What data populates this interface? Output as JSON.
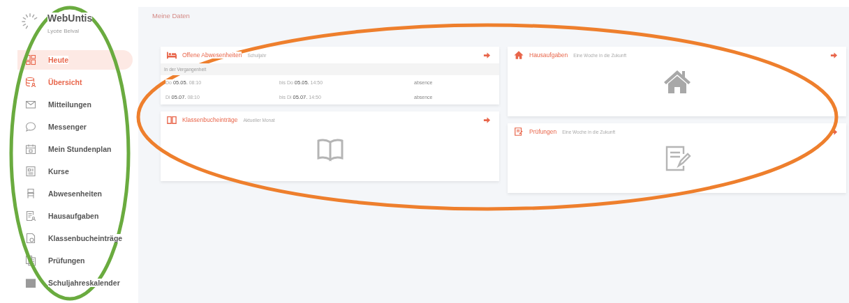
{
  "sidebar": {
    "app_name": "WebUntis",
    "school": "Lycée Belval",
    "items": [
      {
        "label": "Heute",
        "selected": true,
        "highlighted": true
      },
      {
        "label": "Übersicht",
        "selected": false,
        "highlighted": true
      },
      {
        "label": "Mitteilungen",
        "selected": false,
        "highlighted": false
      },
      {
        "label": "Messenger",
        "selected": false,
        "highlighted": false
      },
      {
        "label": "Mein Stundenplan",
        "selected": false,
        "highlighted": false
      },
      {
        "label": "Kurse",
        "selected": false,
        "highlighted": false
      },
      {
        "label": "Abwesenheiten",
        "selected": false,
        "highlighted": false
      },
      {
        "label": "Hausaufgaben",
        "selected": false,
        "highlighted": false
      },
      {
        "label": "Klassenbucheinträge",
        "selected": false,
        "highlighted": false
      },
      {
        "label": "Prüfungen",
        "selected": false,
        "highlighted": false
      },
      {
        "label": "Schuljahreskalender",
        "selected": false,
        "highlighted": false
      }
    ]
  },
  "page_title": "Meine Daten",
  "columns": [
    [
      {
        "kind": "absences",
        "title": "Offene Abwesenheiten",
        "subtitle": "Schuljahr",
        "section": "In der Vergangenheit",
        "rows": [
          {
            "from_day": "Do",
            "from_date": "05.05.",
            "from_time": "08:10",
            "to_day": "bis Do",
            "to_date": "05.05.",
            "to_time": "14:50",
            "reason": "absence"
          },
          {
            "from_day": "Di",
            "from_date": "05.07.",
            "from_time": "08:10",
            "to_day": "bis Di",
            "to_date": "05.07.",
            "to_time": "14:50",
            "reason": "absence"
          }
        ]
      },
      {
        "kind": "empty",
        "title": "Klassenbucheinträge",
        "subtitle": "Aktueller Monat"
      }
    ],
    [
      {
        "kind": "empty",
        "title": "Hausaufgaben",
        "subtitle": "Eine Woche in die Zukunft"
      },
      {
        "kind": "empty",
        "title": "Prüfungen",
        "subtitle": "Eine Woche in die Zukunft"
      }
    ]
  ],
  "annotations": [
    {
      "kind": "ellipse",
      "color": "#6aab3f"
    },
    {
      "kind": "ellipse",
      "color": "#ee7f2d"
    }
  ]
}
